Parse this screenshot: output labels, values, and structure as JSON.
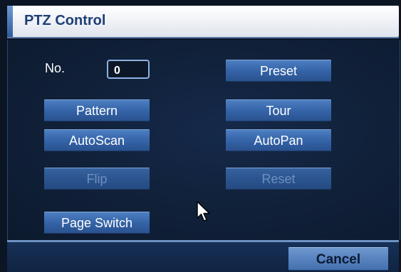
{
  "window": {
    "title": "PTZ Control"
  },
  "form": {
    "no_label": "No.",
    "no_value": "0"
  },
  "buttons": {
    "preset": "Preset",
    "pattern": "Pattern",
    "tour": "Tour",
    "autoscan": "AutoScan",
    "autopan": "AutoPan",
    "flip": "Flip",
    "reset": "Reset",
    "page_switch": "Page Switch",
    "cancel": "Cancel"
  },
  "state": {
    "flip_enabled": false,
    "reset_enabled": false
  },
  "icons": {
    "cursor": "mouse-pointer-icon"
  },
  "colors": {
    "title_text": "#1f3f76",
    "button": "#3564a8",
    "panel_bg": "#102038",
    "disabled_text": "#6d8fbf"
  }
}
